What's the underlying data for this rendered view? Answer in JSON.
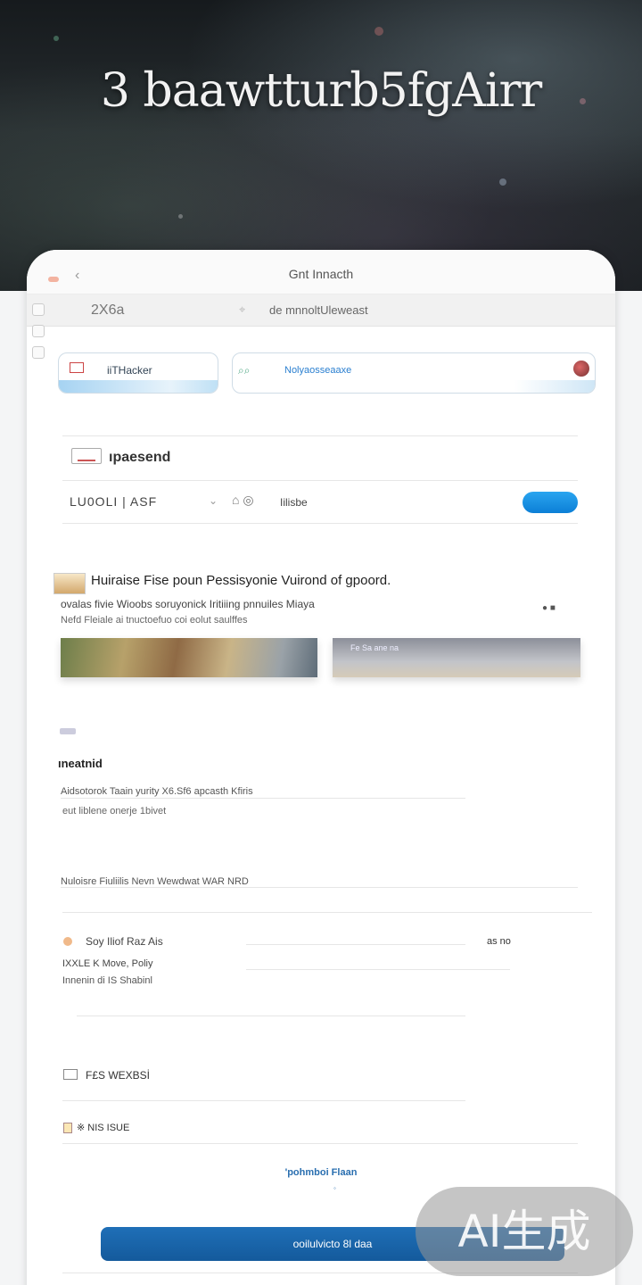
{
  "hero": {
    "title": "3 baawtturb5fgAirr"
  },
  "browser": {
    "tab_title": "Gnt Innacth",
    "back_icon": "chevron-left-icon",
    "address_number": "2X6a",
    "address_text": "de mnnoltUleweast"
  },
  "search": {
    "left_label": "iiTHacker",
    "right_label": "Nolyaosseaaxe"
  },
  "prepend": {
    "label": "ıpaesend"
  },
  "toolbar": {
    "text": "LU0OLI | ASF",
    "chevron": "⌄",
    "icons": "⌂ ◎",
    "label": "Iilisbe"
  },
  "article": {
    "title": "Huiraise Fise poun Pessisyonie Vuirond of gpoord.",
    "subtitle": "ovalas fivie Wioobs soruyonick Iritiiing pnnuiles Miaya",
    "caption": "Nefd Fleiale ai tnuctoefuo coi eolut saulffes",
    "image_b_text": "Fe Sa ane na"
  },
  "section": {
    "heading": "ıneatnid",
    "line1": "Aidsotorok Taain yurity X6.Sf6 apcasth Kfiris",
    "line2": "eut liblene onerje 1bivet",
    "line3": "Nuloisre Fiuliilis Nevn Wewdwat WAR NRD"
  },
  "event": {
    "name": "Soy Iliof Raz Ais",
    "right": "as no",
    "meta": "IXXLE K Move, Poliy",
    "meta2": "Innenin di IS Shabinl"
  },
  "news": {
    "item1": "F£S WEXBSİ",
    "item2": "※ NIS ISUE"
  },
  "footer": {
    "link": "'pohmboi Flaan",
    "dot": "◦",
    "cta": "ooilulvicto 8l daa"
  },
  "watermark": {
    "text": "AI生成"
  }
}
